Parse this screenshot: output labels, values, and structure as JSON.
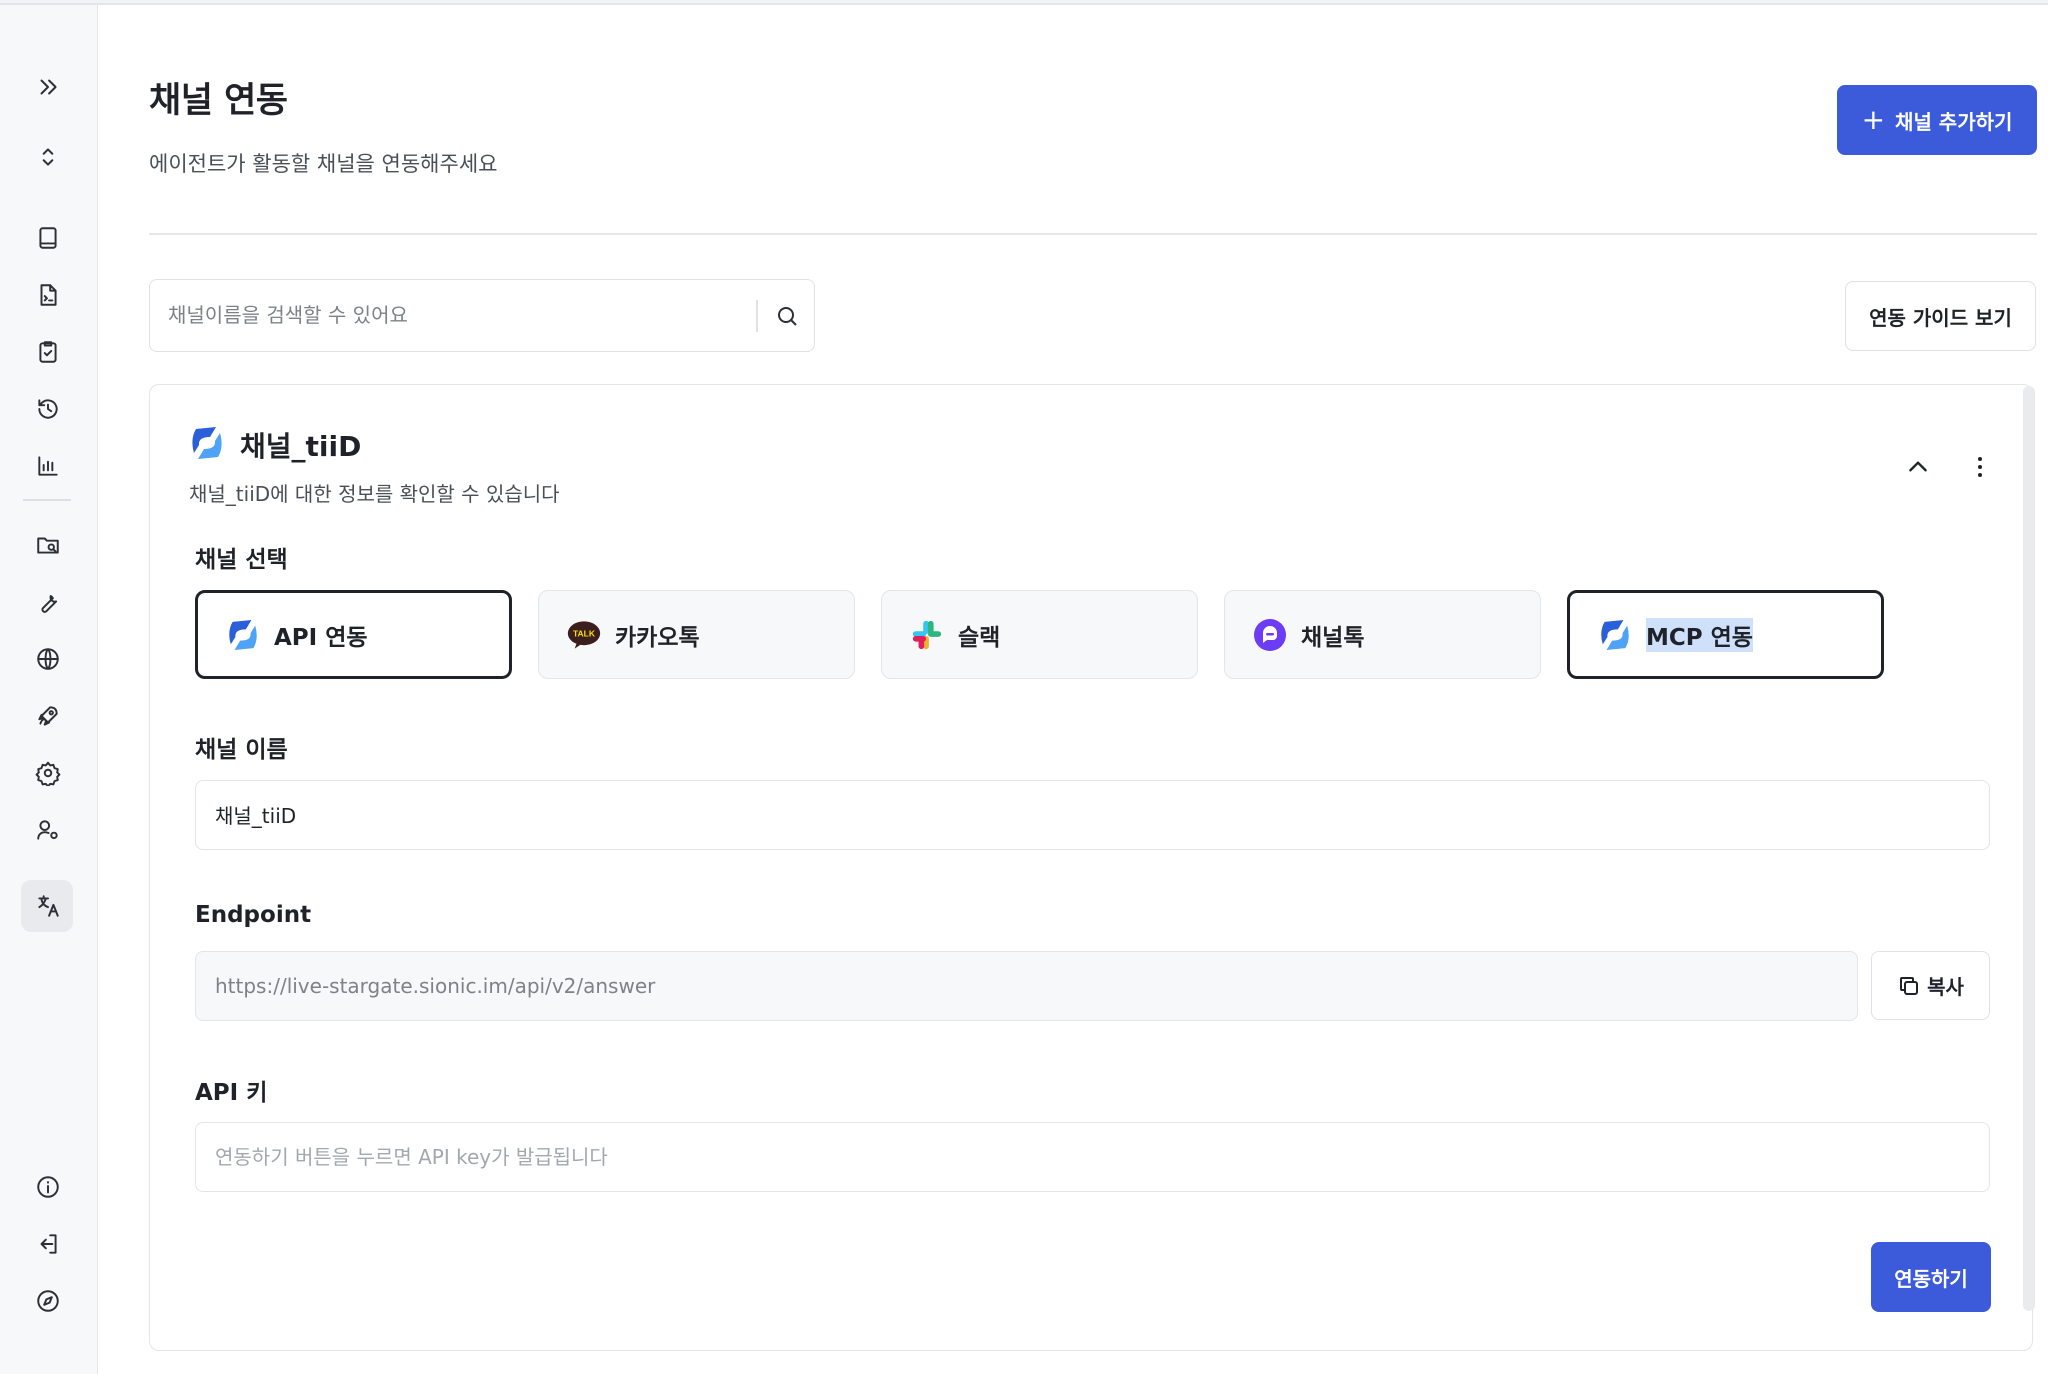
{
  "page": {
    "title": "채널 연동",
    "subtitle": "에이전트가 활동할 채널을 연동해주세요",
    "add_button_label": "채널 추가하기",
    "guide_button_label": "연동 가이드 보기"
  },
  "search": {
    "placeholder": "채널이름을 검색할 수 있어요",
    "value": ""
  },
  "sidebar": {
    "items": [
      {
        "icon": "chevrons-right-icon"
      },
      {
        "icon": "chevron-up-down-icon"
      },
      {
        "icon": "book-icon"
      },
      {
        "icon": "file-code-icon"
      },
      {
        "icon": "clipboard-check-icon"
      },
      {
        "icon": "history-icon"
      },
      {
        "icon": "bar-chart-icon"
      },
      {
        "icon": "folder-icon"
      },
      {
        "icon": "wrench-icon"
      },
      {
        "icon": "globe-icon"
      },
      {
        "icon": "rocket-icon"
      },
      {
        "icon": "gear-icon"
      },
      {
        "icon": "user-settings-icon"
      },
      {
        "icon": "translate-icon"
      },
      {
        "icon": "info-icon"
      },
      {
        "icon": "logout-icon"
      },
      {
        "icon": "compass-icon"
      }
    ]
  },
  "card": {
    "title": "채널_tiiD",
    "description": "채널_tiiD에 대한 정보를 확인할 수 있습니다",
    "channel_select_label": "채널 선택",
    "channels": [
      {
        "label": "API 연동",
        "icon": "sionic-logo-icon",
        "selected": true
      },
      {
        "label": "카카오톡",
        "icon": "kakaotalk-icon",
        "selected": false
      },
      {
        "label": "슬랙",
        "icon": "slack-icon",
        "selected": false
      },
      {
        "label": "채널톡",
        "icon": "channeltalk-icon",
        "selected": false
      },
      {
        "label": "MCP 연동",
        "icon": "sionic-logo-icon",
        "selected": true
      }
    ],
    "kakao_badge": "TALK",
    "channel_name_label": "채널 이름",
    "channel_name_value": "채널_tiiD",
    "endpoint_label": "Endpoint",
    "endpoint_value": "https://live-stargate.sionic.im/api/v2/answer",
    "copy_label": "복사",
    "api_key_label": "API 키",
    "api_key_placeholder": "연동하기 버튼을 누르면 API key가 발급됩니다",
    "connect_label": "연동하기"
  },
  "colors": {
    "primary": "#3b5bdb",
    "border": "#e3e5e8",
    "text": "#1f2329",
    "muted": "#4a4f57",
    "sidebar_bg": "#f7f8fa",
    "kakao_yellow": "#3c1e1e",
    "channeltalk_purple": "#6c3df4"
  }
}
